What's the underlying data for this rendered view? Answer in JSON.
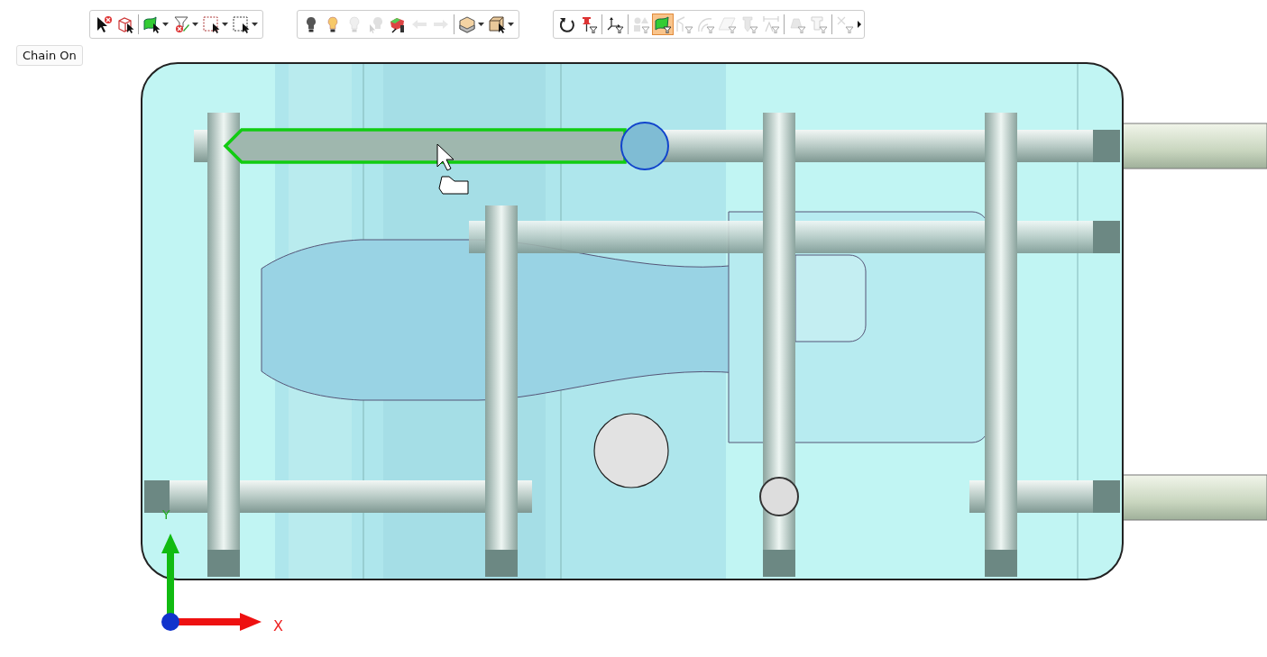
{
  "toolbars": [
    {
      "overflow": false,
      "groups": [
        [
          {
            "kind": "select-clear",
            "disabled": false,
            "selected": false,
            "dropdown": false
          },
          {
            "kind": "box-select",
            "disabled": false,
            "selected": false,
            "dropdown": false
          }
        ],
        [
          {
            "kind": "face-select",
            "disabled": false,
            "selected": false,
            "dropdown": true
          },
          {
            "kind": "filter-clear",
            "disabled": false,
            "selected": false,
            "dropdown": true
          },
          {
            "kind": "window-select",
            "disabled": false,
            "selected": false,
            "dropdown": true
          },
          {
            "kind": "window-select-dark",
            "disabled": false,
            "selected": false,
            "dropdown": true
          }
        ]
      ]
    },
    {
      "overflow": false,
      "groups": [
        [
          {
            "kind": "bulb-dark",
            "disabled": false,
            "selected": false,
            "dropdown": false
          },
          {
            "kind": "bulb-light",
            "disabled": false,
            "selected": false,
            "dropdown": false
          },
          {
            "kind": "bulb-off",
            "disabled": true,
            "selected": false,
            "dropdown": false
          },
          {
            "kind": "bulb-cursor",
            "disabled": true,
            "selected": false,
            "dropdown": false
          },
          {
            "kind": "solid-color",
            "disabled": false,
            "selected": false,
            "dropdown": false
          },
          {
            "kind": "arrow-left",
            "disabled": true,
            "selected": false,
            "dropdown": false
          },
          {
            "kind": "arrow-right",
            "disabled": true,
            "selected": false,
            "dropdown": false
          }
        ],
        [
          {
            "kind": "view-box",
            "disabled": false,
            "selected": false,
            "dropdown": true
          },
          {
            "kind": "box-cursor",
            "disabled": false,
            "selected": false,
            "dropdown": true
          }
        ]
      ]
    },
    {
      "overflow": true,
      "groups": [
        [
          {
            "kind": "rotate",
            "disabled": false,
            "selected": false,
            "dropdown": false
          },
          {
            "kind": "pin-filter",
            "disabled": false,
            "selected": false,
            "dropdown": false
          }
        ],
        [
          {
            "kind": "axis-filter",
            "disabled": false,
            "selected": false,
            "dropdown": false
          }
        ],
        [
          {
            "kind": "shapes-filter",
            "disabled": true,
            "selected": false,
            "dropdown": false
          },
          {
            "kind": "face-filter",
            "disabled": false,
            "selected": true,
            "dropdown": false
          },
          {
            "kind": "edge-filter",
            "disabled": true,
            "selected": false,
            "dropdown": false
          },
          {
            "kind": "arc-filter",
            "disabled": true,
            "selected": false,
            "dropdown": false
          },
          {
            "kind": "plane-filter",
            "disabled": true,
            "selected": false,
            "dropdown": false
          },
          {
            "kind": "drill-filter",
            "disabled": true,
            "selected": false,
            "dropdown": false
          },
          {
            "kind": "dim-filter",
            "disabled": true,
            "selected": false,
            "dropdown": false
          }
        ],
        [
          {
            "kind": "solid-filter",
            "disabled": true,
            "selected": false,
            "dropdown": false
          },
          {
            "kind": "profile-filter",
            "disabled": true,
            "selected": false,
            "dropdown": false
          }
        ],
        [
          {
            "kind": "point-filter",
            "disabled": true,
            "selected": false,
            "dropdown": false
          }
        ]
      ]
    }
  ],
  "chain_button": {
    "label": "Chain On"
  },
  "axes": {
    "y_label": "Y",
    "x_label": "X"
  }
}
